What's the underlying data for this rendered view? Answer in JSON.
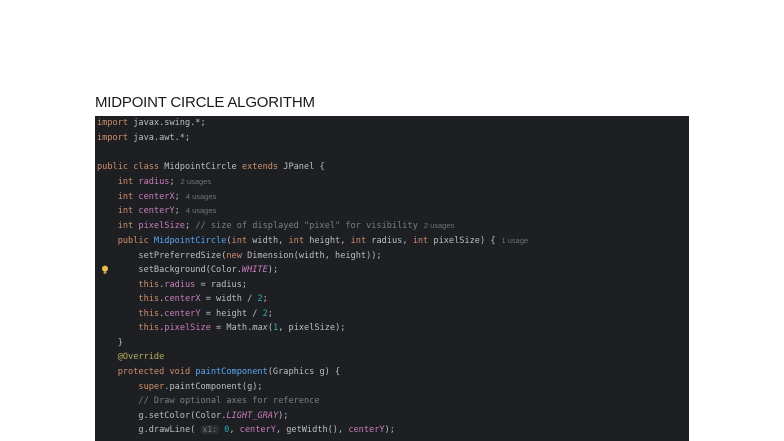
{
  "slide": {
    "title": "MIDPOINT CIRCLE ALGORITHM"
  },
  "code": {
    "l1_kw": "import",
    "l1_rest": " javax.swing.*;",
    "l2_kw": "import",
    "l2_rest": " java.awt.*;",
    "l4_kw1": "public class",
    "l4_name": " MidpointCircle ",
    "l4_kw2": "extends",
    "l4_rest": " JPanel {",
    "l5_kw": "int",
    "l5_fld": " radius",
    "l5_semi": ";",
    "l5_hint": "2 usages",
    "l6_kw": "int",
    "l6_fld": " centerX",
    "l6_semi": ";",
    "l6_hint": "4 usages",
    "l7_kw": "int",
    "l7_fld": " centerY",
    "l7_semi": ";",
    "l7_hint": "4 usages",
    "l8_kw": "int",
    "l8_fld": " pixelSize",
    "l8_semi": "; ",
    "l8_cmt": "// size of displayed \"pixel\" for visibility",
    "l8_hint": "2 usages",
    "l9_kw": "public",
    "l9_fn": " MidpointCircle",
    "l9_p1": "(",
    "l9_k1": "int",
    "l9_p2": " width, ",
    "l9_k2": "int",
    "l9_p3": " height, ",
    "l9_k3": "int",
    "l9_p4": " radius, ",
    "l9_k4": "int",
    "l9_p5": " pixelSize) {",
    "l9_hint": "1 usage",
    "l10_a": "setPreferredSize(",
    "l10_kw": "new",
    "l10_b": " Dimension(width, height));",
    "l11_a": "setBackground(Color.",
    "l11_c": "WHITE",
    "l11_b": ");",
    "l12_kw": "this",
    "l12_dot": ".",
    "l12_fld": "radius",
    "l12_rest": " = radius;",
    "l13_kw": "this",
    "l13_dot": ".",
    "l13_fld": "centerX",
    "l13_rest": " = width / ",
    "l13_num": "2",
    "l13_end": ";",
    "l14_kw": "this",
    "l14_dot": ".",
    "l14_fld": "centerY",
    "l14_rest": " = height / ",
    "l14_num": "2",
    "l14_end": ";",
    "l15_kw": "this",
    "l15_dot": ".",
    "l15_fld": "pixelSize",
    "l15_a": " = Math.",
    "l15_fn": "max",
    "l15_b": "(",
    "l15_num": "1",
    "l15_c": ", pixelSize);",
    "l16": "}",
    "l17_ann": "@Override",
    "l18_kw": "protected void",
    "l18_fn": " paintComponent",
    "l18_rest": "(Graphics g) {",
    "l19_kw": "super",
    "l19_rest": ".paintComponent(g);",
    "l20_cmt": "// Draw optional axes for reference",
    "l21_a": "g.setColor(Color.",
    "l21_c": "LIGHT_GRAY",
    "l21_b": ");",
    "l22_a": "g.drawLine( ",
    "l22_hint": "x1:",
    "l22_num": " 0",
    "l22_b": ", ",
    "l22_fld": "centerY",
    "l22_c": ", getWidth(), ",
    "l22_fld2": "centerY",
    "l22_d": ");"
  }
}
